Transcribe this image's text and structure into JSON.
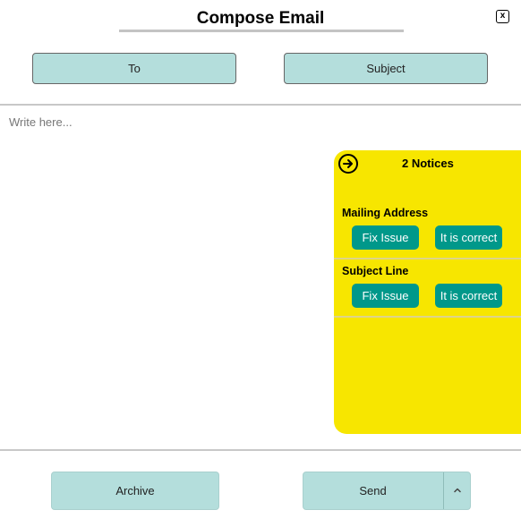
{
  "header": {
    "title": "Compose Email",
    "close_label": "x"
  },
  "fields": {
    "to_label": "To",
    "subject_label": "Subject"
  },
  "body": {
    "placeholder": "Write here..."
  },
  "notices_panel": {
    "header": "2 Notices",
    "items": [
      {
        "title": "Mailing Address",
        "fix_label": "Fix Issue",
        "correct_label": "It is correct"
      },
      {
        "title": "Subject Line",
        "fix_label": "Fix Issue",
        "correct_label": "It is correct"
      }
    ]
  },
  "footer": {
    "archive_label": "Archive",
    "send_label": "Send"
  },
  "colors": {
    "field_button": "#b4dedc",
    "notice_panel": "#f7e600",
    "notice_button": "#00988a"
  }
}
